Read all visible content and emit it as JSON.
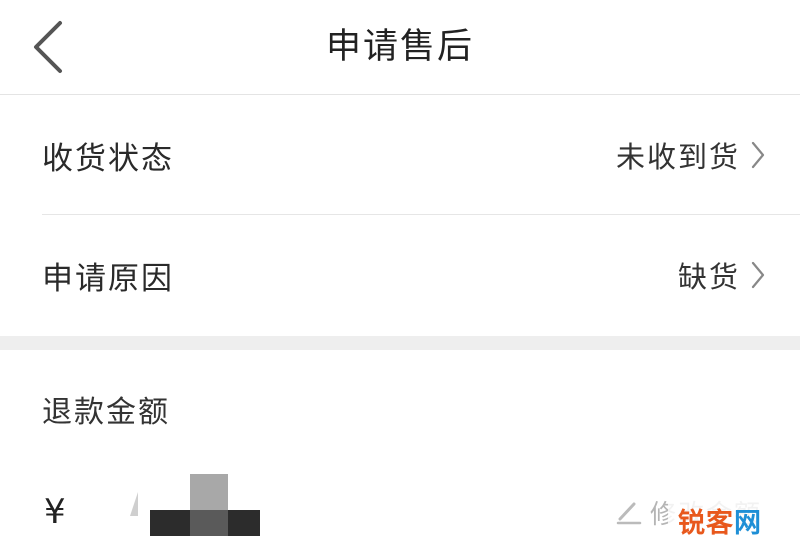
{
  "header": {
    "title": "申请售后",
    "back_icon": "chevron-left-icon"
  },
  "rows": [
    {
      "label": "收货状态",
      "value": "未收到货",
      "icon": "chevron-right-icon"
    },
    {
      "label": "申请原因",
      "value": "缺货",
      "icon": "chevron-right-icon"
    }
  ],
  "refund": {
    "title": "退款金额",
    "currency": "¥",
    "modify_label": "修改金额",
    "modify_icon": "pencil-icon"
  },
  "watermark": {
    "part1": "锐客",
    "part2": "网"
  },
  "colors": {
    "text": "#2b2b2b",
    "muted": "#b5b5b5",
    "divider": "#e6e6e6",
    "section_gap": "#eeeeee",
    "watermark_orange": "#e8581c",
    "watermark_blue": "#1e8fd6"
  }
}
